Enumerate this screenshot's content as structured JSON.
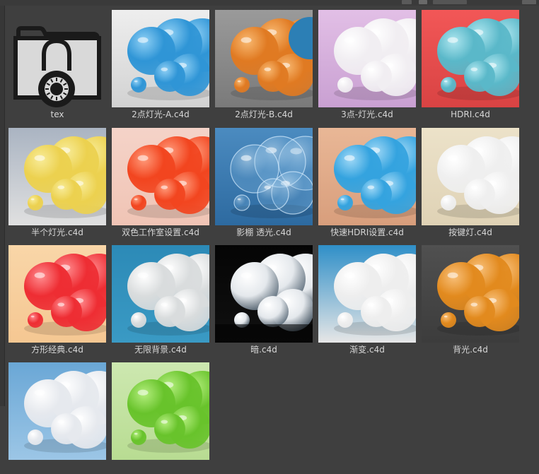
{
  "files": [
    {
      "label": "tex",
      "kind": "folder",
      "icon": "locked-folder-icon"
    },
    {
      "label": "2点灯光-A.c4d",
      "bg_top": "#eeeeee",
      "bg_bottom": "#d2d2d2",
      "ball": "#2f95d6",
      "ball_hi": "#8fd0f5"
    },
    {
      "label": "2点灯光-B.c4d",
      "bg_top": "#9a9a9a",
      "bg_bottom": "#7a7a7a",
      "ball": "#e07a22",
      "ball_hi": "#f8b870",
      "accent": "#2c7fb5"
    },
    {
      "label": "3点-灯光.c4d",
      "bg_top": "#e2bfe6",
      "bg_bottom": "#c9a0d2",
      "ball": "#f1eef2",
      "ball_hi": "#ffffff"
    },
    {
      "label": "HDRI.c4d",
      "bg_top": "#f25757",
      "bg_bottom": "#d94343",
      "ball": "#5ab8c9",
      "ball_hi": "#aee6ef"
    },
    {
      "label": "半个灯光.c4d",
      "bg_top": "#aab4c2",
      "bg_bottom": "#e0e0e0",
      "ball": "#ecd14f",
      "ball_hi": "#f8ec99"
    },
    {
      "label": "双色工作室设置.c4d",
      "bg_top": "#f4d3c8",
      "bg_bottom": "#f0c4b5",
      "ball": "#f2451f",
      "ball_hi": "#ff9a7a"
    },
    {
      "label": "影棚 透光.c4d",
      "bg_top": "#4b8bc0",
      "bg_bottom": "#2d6aa0",
      "ball": "#7fb6e0",
      "ball_hi": "#e8f6ff",
      "glass": true
    },
    {
      "label": "快速HDRI设置.c4d",
      "bg_top": "#e9b796",
      "bg_bottom": "#d89e7c",
      "ball": "#34a3df",
      "ball_hi": "#9fd8f6"
    },
    {
      "label": "按键灯.c4d",
      "bg_top": "#ece2c9",
      "bg_bottom": "#dfd2b5",
      "ball": "#efefef",
      "ball_hi": "#ffffff"
    },
    {
      "label": "方形经典.c4d",
      "bg_top": "#f9d6a8",
      "bg_bottom": "#f5c792",
      "ball": "#ee2d33",
      "ball_hi": "#ff8c8f"
    },
    {
      "label": "无限背景.c4d",
      "bg_top": "#2c8ab7",
      "bg_bottom": "#3a9ac4",
      "ball": "#d9dcdd",
      "ball_hi": "#ffffff"
    },
    {
      "label": "暗.c4d",
      "bg_top": "#050505",
      "bg_bottom": "#101010",
      "ball": "#e4e8ec",
      "ball_hi": "#ffffff",
      "dark": true
    },
    {
      "label": "渐变.c4d",
      "bg_top": "#2f8fc8",
      "bg_bottom": "#e6e6e6",
      "ball": "#eeeeee",
      "ball_hi": "#ffffff"
    },
    {
      "label": "背光.c4d",
      "bg_top": "#505050",
      "bg_bottom": "#3c3c3c",
      "ball": "#e28a1e",
      "ball_hi": "#f8c07a"
    },
    {
      "label": "",
      "bg_top": "#6aa7d6",
      "bg_bottom": "#9cc6e6",
      "ball": "#e6e9ee",
      "ball_hi": "#ffffff"
    },
    {
      "label": "",
      "bg_top": "#cde8b0",
      "bg_bottom": "#b8dc92",
      "ball": "#68c32b",
      "ball_hi": "#b4ee7e"
    }
  ]
}
